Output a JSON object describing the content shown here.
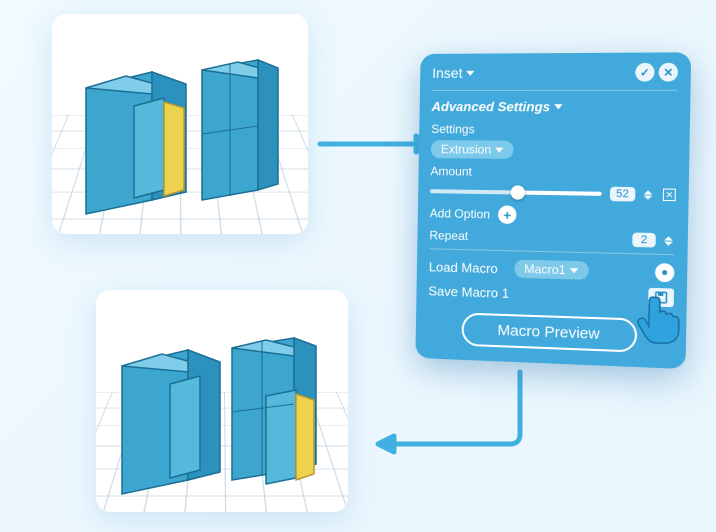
{
  "panel": {
    "title": "Inset",
    "advanced_label": "Advanced Settings",
    "settings_label": "Settings",
    "extrusion_label": "Extrusion",
    "amount_label": "Amount",
    "amount_value": "52",
    "add_option_label": "Add Option",
    "repeat_label": "Repeat",
    "repeat_value": "2",
    "load_macro_label": "Load Macro",
    "macro_selected": "Macro1",
    "save_macro_label": "Save Macro 1",
    "macro_preview_label": "Macro Preview"
  }
}
